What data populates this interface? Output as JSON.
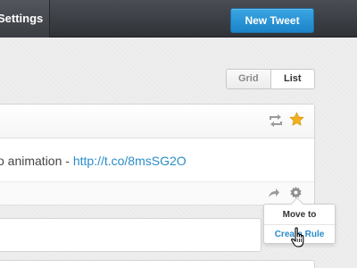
{
  "topbar": {
    "nav_settings_label": "Settings",
    "new_tweet_label": "New Tweet"
  },
  "view_toggle": {
    "options": [
      "Grid",
      "List"
    ],
    "selected": "List"
  },
  "tweet": {
    "text": "o animation - ",
    "link": "http://t.co/8msSG2O",
    "header_icons": [
      "retweet-icon",
      "star-icon"
    ],
    "footer_icons": [
      "share-icon",
      "gear-icon"
    ],
    "starred": true
  },
  "dropdown_menu": {
    "items": [
      "Move to",
      "Create Rule"
    ],
    "hovered": "Create Rule"
  },
  "colors": {
    "accent_blue": "#1c83c9",
    "link_blue": "#2a8cc7",
    "star_gold": "#f2b01e",
    "topbar_dark": "#2f3237"
  }
}
